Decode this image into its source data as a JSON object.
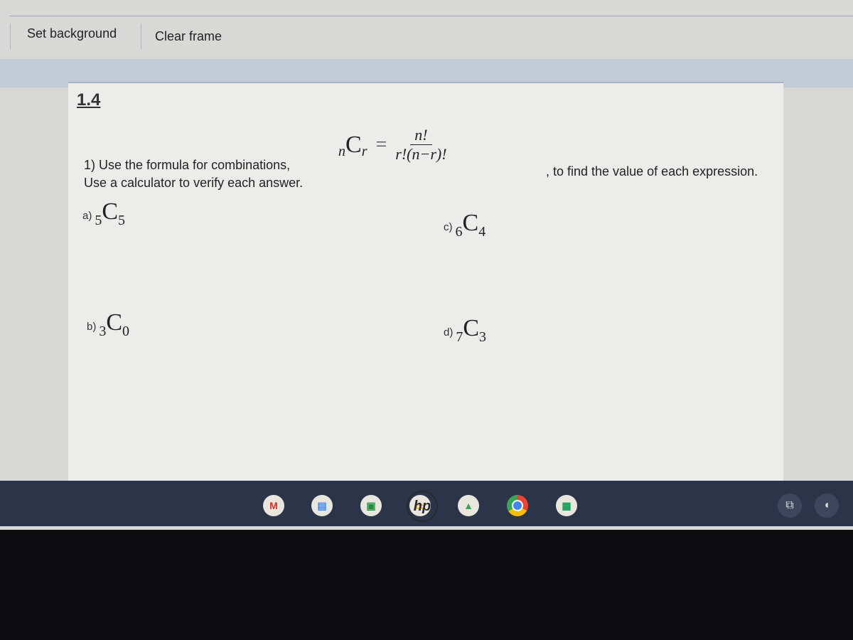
{
  "toolbar": {
    "set_background": "Set background",
    "clear_frame": "Clear frame"
  },
  "panel": {
    "title": "1.4",
    "question_line1": "1) Use the formula for combinations,",
    "question_line2": "Use a calculator to verify each answer.",
    "formula": {
      "lhs_pre": "n",
      "lhs_C": "C",
      "lhs_sub": "r",
      "equals": "=",
      "numerator": "n!",
      "denominator": "r!(n−r)!"
    },
    "question_tail": ", to find the value of each expression.",
    "items": [
      {
        "label": "a)",
        "n": "5",
        "r": "5"
      },
      {
        "label": "b)",
        "n": "3",
        "r": "0"
      },
      {
        "label": "c)",
        "n": "6",
        "r": "4"
      },
      {
        "label": "d)",
        "n": "7",
        "r": "3"
      }
    ]
  },
  "shelf": {
    "apps": [
      "gmail-icon",
      "docs-icon",
      "classroom-icon",
      "slides-icon",
      "drive-icon",
      "chrome-icon",
      "sheets-icon"
    ],
    "tray": [
      "screenshot-icon",
      "volume-icon"
    ]
  },
  "bezel": {
    "logo": "hp"
  }
}
